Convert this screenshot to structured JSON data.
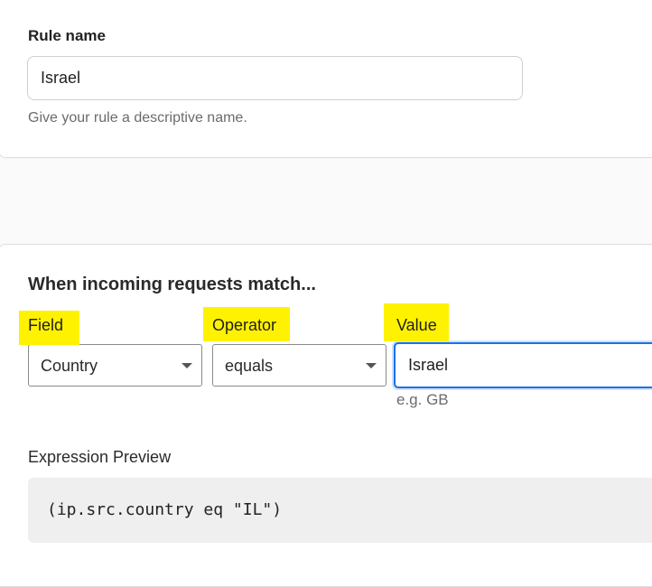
{
  "rule_name": {
    "label": "Rule name",
    "value": "Israel",
    "help": "Give your rule a descriptive name."
  },
  "match": {
    "heading": "When incoming requests match...",
    "field": {
      "label": "Field",
      "selected": "Country"
    },
    "operator": {
      "label": "Operator",
      "selected": "equals"
    },
    "value": {
      "label": "Value",
      "value": "Israel",
      "example": "e.g. GB"
    }
  },
  "preview": {
    "label": "Expression Preview",
    "expression": "(ip.src.country eq \"IL\")"
  },
  "colors": {
    "highlight": "#fff200",
    "focus_border": "#1a73e8",
    "code_background": "#efefef"
  },
  "icons": {
    "dropdown": "chevron-down-icon"
  }
}
